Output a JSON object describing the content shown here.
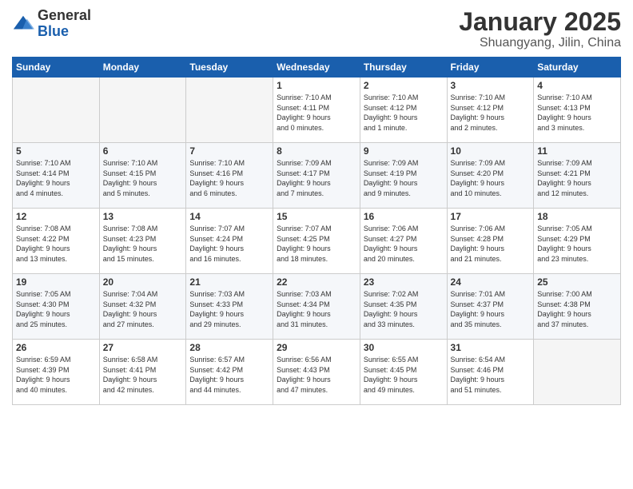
{
  "logo": {
    "general": "General",
    "blue": "Blue"
  },
  "title": "January 2025",
  "subtitle": "Shuangyang, Jilin, China",
  "weekdays": [
    "Sunday",
    "Monday",
    "Tuesday",
    "Wednesday",
    "Thursday",
    "Friday",
    "Saturday"
  ],
  "weeks": [
    [
      {
        "day": "",
        "info": ""
      },
      {
        "day": "",
        "info": ""
      },
      {
        "day": "",
        "info": ""
      },
      {
        "day": "1",
        "info": "Sunrise: 7:10 AM\nSunset: 4:11 PM\nDaylight: 9 hours\nand 0 minutes."
      },
      {
        "day": "2",
        "info": "Sunrise: 7:10 AM\nSunset: 4:12 PM\nDaylight: 9 hours\nand 1 minute."
      },
      {
        "day": "3",
        "info": "Sunrise: 7:10 AM\nSunset: 4:12 PM\nDaylight: 9 hours\nand 2 minutes."
      },
      {
        "day": "4",
        "info": "Sunrise: 7:10 AM\nSunset: 4:13 PM\nDaylight: 9 hours\nand 3 minutes."
      }
    ],
    [
      {
        "day": "5",
        "info": "Sunrise: 7:10 AM\nSunset: 4:14 PM\nDaylight: 9 hours\nand 4 minutes."
      },
      {
        "day": "6",
        "info": "Sunrise: 7:10 AM\nSunset: 4:15 PM\nDaylight: 9 hours\nand 5 minutes."
      },
      {
        "day": "7",
        "info": "Sunrise: 7:10 AM\nSunset: 4:16 PM\nDaylight: 9 hours\nand 6 minutes."
      },
      {
        "day": "8",
        "info": "Sunrise: 7:09 AM\nSunset: 4:17 PM\nDaylight: 9 hours\nand 7 minutes."
      },
      {
        "day": "9",
        "info": "Sunrise: 7:09 AM\nSunset: 4:19 PM\nDaylight: 9 hours\nand 9 minutes."
      },
      {
        "day": "10",
        "info": "Sunrise: 7:09 AM\nSunset: 4:20 PM\nDaylight: 9 hours\nand 10 minutes."
      },
      {
        "day": "11",
        "info": "Sunrise: 7:09 AM\nSunset: 4:21 PM\nDaylight: 9 hours\nand 12 minutes."
      }
    ],
    [
      {
        "day": "12",
        "info": "Sunrise: 7:08 AM\nSunset: 4:22 PM\nDaylight: 9 hours\nand 13 minutes."
      },
      {
        "day": "13",
        "info": "Sunrise: 7:08 AM\nSunset: 4:23 PM\nDaylight: 9 hours\nand 15 minutes."
      },
      {
        "day": "14",
        "info": "Sunrise: 7:07 AM\nSunset: 4:24 PM\nDaylight: 9 hours\nand 16 minutes."
      },
      {
        "day": "15",
        "info": "Sunrise: 7:07 AM\nSunset: 4:25 PM\nDaylight: 9 hours\nand 18 minutes."
      },
      {
        "day": "16",
        "info": "Sunrise: 7:06 AM\nSunset: 4:27 PM\nDaylight: 9 hours\nand 20 minutes."
      },
      {
        "day": "17",
        "info": "Sunrise: 7:06 AM\nSunset: 4:28 PM\nDaylight: 9 hours\nand 21 minutes."
      },
      {
        "day": "18",
        "info": "Sunrise: 7:05 AM\nSunset: 4:29 PM\nDaylight: 9 hours\nand 23 minutes."
      }
    ],
    [
      {
        "day": "19",
        "info": "Sunrise: 7:05 AM\nSunset: 4:30 PM\nDaylight: 9 hours\nand 25 minutes."
      },
      {
        "day": "20",
        "info": "Sunrise: 7:04 AM\nSunset: 4:32 PM\nDaylight: 9 hours\nand 27 minutes."
      },
      {
        "day": "21",
        "info": "Sunrise: 7:03 AM\nSunset: 4:33 PM\nDaylight: 9 hours\nand 29 minutes."
      },
      {
        "day": "22",
        "info": "Sunrise: 7:03 AM\nSunset: 4:34 PM\nDaylight: 9 hours\nand 31 minutes."
      },
      {
        "day": "23",
        "info": "Sunrise: 7:02 AM\nSunset: 4:35 PM\nDaylight: 9 hours\nand 33 minutes."
      },
      {
        "day": "24",
        "info": "Sunrise: 7:01 AM\nSunset: 4:37 PM\nDaylight: 9 hours\nand 35 minutes."
      },
      {
        "day": "25",
        "info": "Sunrise: 7:00 AM\nSunset: 4:38 PM\nDaylight: 9 hours\nand 37 minutes."
      }
    ],
    [
      {
        "day": "26",
        "info": "Sunrise: 6:59 AM\nSunset: 4:39 PM\nDaylight: 9 hours\nand 40 minutes."
      },
      {
        "day": "27",
        "info": "Sunrise: 6:58 AM\nSunset: 4:41 PM\nDaylight: 9 hours\nand 42 minutes."
      },
      {
        "day": "28",
        "info": "Sunrise: 6:57 AM\nSunset: 4:42 PM\nDaylight: 9 hours\nand 44 minutes."
      },
      {
        "day": "29",
        "info": "Sunrise: 6:56 AM\nSunset: 4:43 PM\nDaylight: 9 hours\nand 47 minutes."
      },
      {
        "day": "30",
        "info": "Sunrise: 6:55 AM\nSunset: 4:45 PM\nDaylight: 9 hours\nand 49 minutes."
      },
      {
        "day": "31",
        "info": "Sunrise: 6:54 AM\nSunset: 4:46 PM\nDaylight: 9 hours\nand 51 minutes."
      },
      {
        "day": "",
        "info": ""
      }
    ]
  ]
}
